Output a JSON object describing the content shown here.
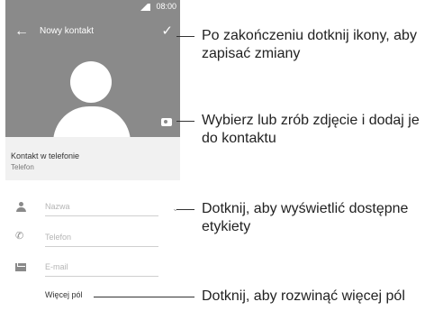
{
  "status_bar": {
    "time": "08:00"
  },
  "app_bar": {
    "title": "Nowy kontakt",
    "back_icon": "arrow-back-icon",
    "save_icon": "check-icon"
  },
  "photo": {
    "camera_icon": "camera-icon"
  },
  "account": {
    "title": "Kontakt w telefonie",
    "subtitle": "Telefon"
  },
  "fields": {
    "name": {
      "placeholder": "Nazwa",
      "icon": "person-icon"
    },
    "phone": {
      "placeholder": "Telefon",
      "icon": "phone-icon"
    },
    "email": {
      "placeholder": "E-mail",
      "icon": "mail-icon"
    }
  },
  "more_fields": "Więcej pól",
  "callouts": {
    "save": "Po zakończeniu dotknij ikony, aby zapisać zmiany",
    "photo": "Wybierz lub zrób zdjęcie i dodaj je do kontaktu",
    "labels": "Dotknij, aby wyświetlić dostępne etykiety",
    "more": "Dotknij, aby rozwinąć więcej pól"
  },
  "colors": {
    "app_bar": "#8a8a8a",
    "account_bg": "#f1f1f1",
    "text": "#222222"
  }
}
